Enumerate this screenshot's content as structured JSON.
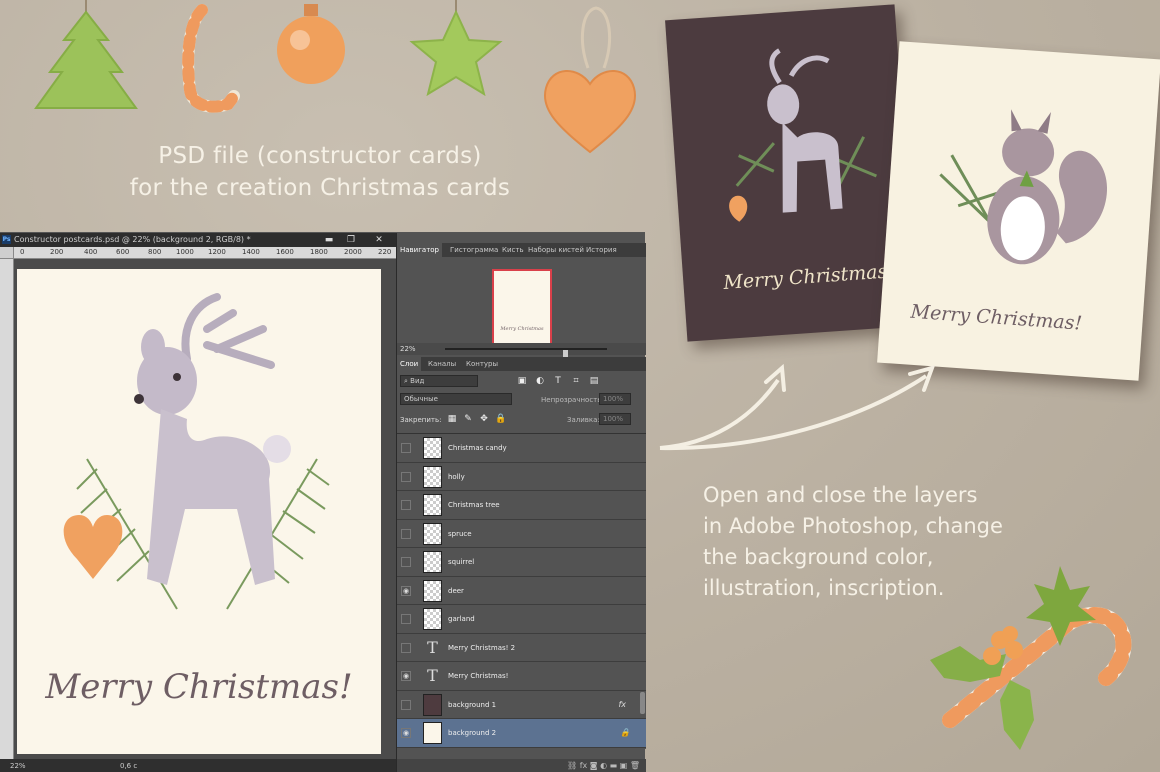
{
  "headline": {
    "line1": "PSD file (constructor  cards)",
    "line2": "for the creation Christmas cards"
  },
  "description": {
    "line1": "Open and close the layers",
    "line2": "in Adobe Photoshop, change",
    "line3": "the background color,",
    "line4": "illustration, inscription."
  },
  "cards": {
    "dark_text": "Merry Christmas",
    "light_text": "Merry Christmas!"
  },
  "photoshop": {
    "title": "Constructor postcards.psd @ 22% (background 2, RGB/8) *",
    "logo": "Ps",
    "window_buttons": [
      "▬",
      "❐",
      "✕"
    ],
    "ruler_ticks": [
      "0",
      "200",
      "400",
      "600",
      "800",
      "1000",
      "1200",
      "1400",
      "1600",
      "1800",
      "2000",
      "220"
    ],
    "document_text": "Merry Christmas!",
    "status_zoom": "22%",
    "status_time": "0,6 c",
    "top_tabs": [
      "Навигатор",
      "Гистограмма",
      "Кисть",
      "Наборы кистей",
      "История"
    ],
    "nav_thumb_text": "Merry Christmas",
    "nav_zoom": "22%",
    "layer_tabs": [
      "Слои",
      "Каналы",
      "Контуры"
    ],
    "filter_label": "Вид",
    "blend_mode": "Обычные",
    "opacity_label": "Непрозрачность:",
    "opacity_value": "100%",
    "lock_label": "Закрепить:",
    "fill_label": "Заливка:",
    "fill_value": "100%",
    "layers": [
      {
        "name": "Christmas candy",
        "visible": false,
        "type": "image"
      },
      {
        "name": "holly",
        "visible": false,
        "type": "image"
      },
      {
        "name": "Christmas tree",
        "visible": false,
        "type": "image"
      },
      {
        "name": "spruce",
        "visible": false,
        "type": "image"
      },
      {
        "name": "squirrel",
        "visible": false,
        "type": "image"
      },
      {
        "name": "deer",
        "visible": true,
        "type": "image"
      },
      {
        "name": "garland",
        "visible": false,
        "type": "image"
      },
      {
        "name": "Merry Christmas! 2",
        "visible": false,
        "type": "text"
      },
      {
        "name": "Merry Christmas!",
        "visible": true,
        "type": "text"
      },
      {
        "name": "background 1",
        "visible": false,
        "type": "brown",
        "badge": "fx"
      },
      {
        "name": "background 2",
        "visible": true,
        "type": "cream",
        "badge": "🔒"
      }
    ],
    "footer_icons": "⛓ fx ◙ ◐ ▬ ▣ 🗑"
  },
  "colors": {
    "background": "#bfb5a6",
    "card_dark": "#4c3b3f",
    "card_light": "#f8f2e1",
    "selected_layer": "#5c7291"
  }
}
